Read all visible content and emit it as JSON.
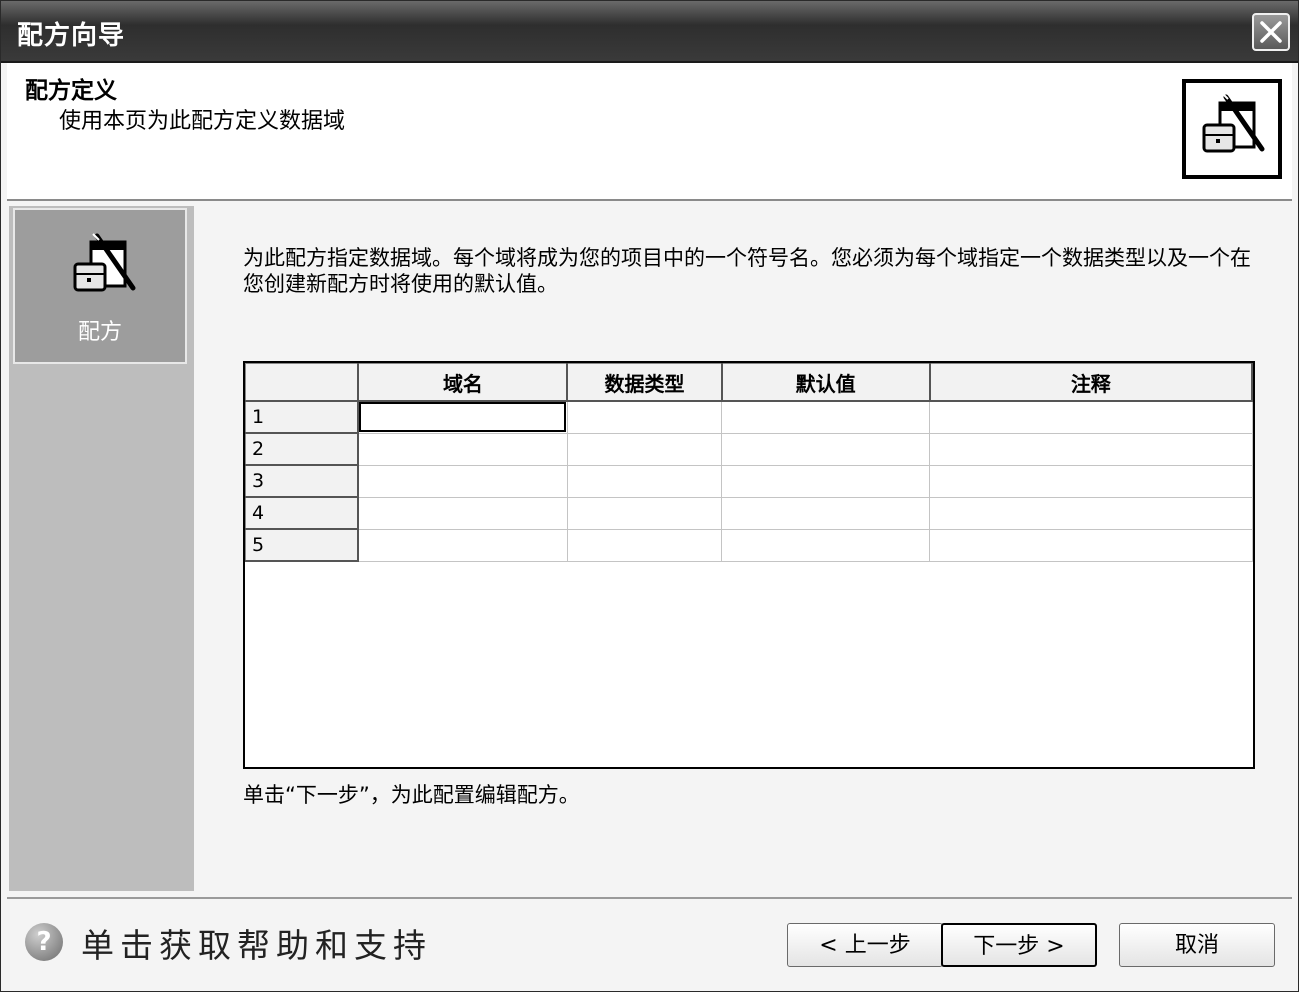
{
  "window": {
    "title": "配方向导"
  },
  "header": {
    "title": "配方定义",
    "subtitle": "使用本页为此配方定义数据域"
  },
  "sidebar": {
    "items": [
      {
        "label": "配方",
        "icon": "recipe-wizard-icon"
      }
    ]
  },
  "main": {
    "instruction": "为此配方指定数据域。每个域将成为您的项目中的一个符号名。您必须为每个域指定一个数据类型以及一个在您创建新配方时将使用的默认值。",
    "grid": {
      "columns": [
        "域名",
        "数据类型",
        "默认值",
        "注释"
      ],
      "rows": [
        "1",
        "2",
        "3",
        "4",
        "5"
      ]
    },
    "hint": "单击“下一步”，为此配置编辑配方。"
  },
  "footer": {
    "help_text": "单击获取帮助和支持",
    "back_label": "< 上一步",
    "next_label": "下一步 >",
    "cancel_label": "取消"
  }
}
